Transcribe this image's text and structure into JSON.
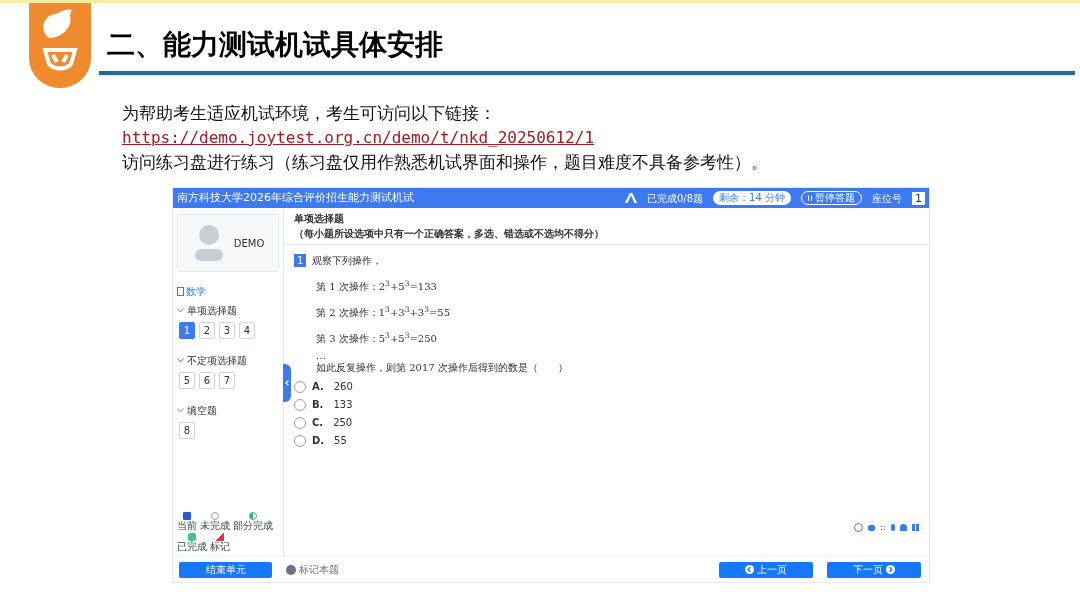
{
  "slide": {
    "title": "二、能力测试机试具体安排",
    "intro": "为帮助考生适应机试环境，考生可访问以下链接：",
    "link": "https://demo.joytest.org.cn/demo/t/nkd_20250612/1",
    "note": "访问练习盘进行练习（练习盘仅用作熟悉机试界面和操作，题目难度不具备参考性）。"
  },
  "app": {
    "title": "南方科技大学2026年综合评价招生能力测试机试",
    "progress": "已完成0/8题",
    "timer": "剩余：14 分钟",
    "pause_button": "暂停答题",
    "seat_label": "座位号",
    "seat_number": "1",
    "profile_name": "DEMO",
    "subject": "数学",
    "sections": [
      {
        "title": "单项选择题",
        "expanded": true,
        "questions": [
          {
            "number": "1",
            "selected": true
          },
          {
            "number": "2",
            "selected": false
          },
          {
            "number": "3",
            "selected": false
          },
          {
            "number": "4",
            "selected": false
          }
        ]
      },
      {
        "title": "不定项选择题",
        "expanded": true,
        "questions": [
          {
            "number": "5",
            "selected": false
          },
          {
            "number": "6",
            "selected": false
          },
          {
            "number": "7",
            "selected": false
          }
        ]
      },
      {
        "title": "填空题",
        "expanded": true,
        "questions": [
          {
            "number": "8",
            "selected": false
          }
        ]
      }
    ],
    "legend": [
      {
        "kind": "current",
        "label": "当前"
      },
      {
        "kind": "unanswered",
        "label": "未完成"
      },
      {
        "kind": "partial",
        "label": "部分完成"
      },
      {
        "kind": "done",
        "label": "已完成"
      },
      {
        "kind": "flagged",
        "label": "标记"
      }
    ],
    "section_heading": "单项选择题",
    "instructions": "（每小题所设选项中只有一个正确答案，多选、错选或不选均不得分）",
    "question": {
      "number": "1",
      "intro": "观察下列操作，",
      "steps": [
        "第 1 次操作：2$^{3}$+5$^{3}$=133",
        "第 2 次操作：1$^{3}$+3$^{3}$+3$^{3}$=55",
        "第 3 次操作：5$^{3}$+5$^{3}$=250"
      ],
      "ellipsis": "…",
      "prompt": "如此反复操作，则第 2017 次操作后得到的数是（　　）",
      "options": [
        {
          "letter": "A.",
          "text": "260",
          "selected": false
        },
        {
          "letter": "B.",
          "text": "133",
          "selected": false
        },
        {
          "letter": "C.",
          "text": "250",
          "selected": false
        },
        {
          "letter": "D.",
          "text": "55",
          "selected": false
        }
      ]
    },
    "finish_button": "结束单元",
    "flag_button": "标记本题",
    "prev_button": "上一页",
    "next_button": "下一页"
  }
}
